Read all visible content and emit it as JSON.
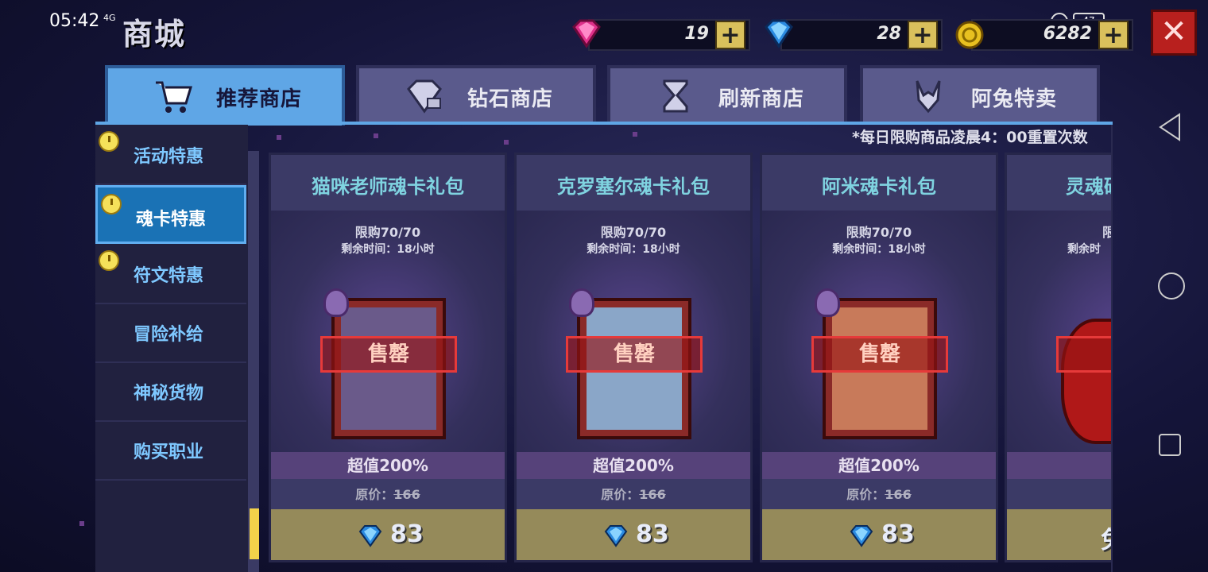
{
  "status_bar": {
    "time": "05:42",
    "signal": "4G",
    "battery": "47"
  },
  "title": "商城",
  "currencies": [
    {
      "name": "pink-gem",
      "value": "19",
      "plus": "+"
    },
    {
      "name": "blue-diamond",
      "value": "28",
      "plus": "+"
    },
    {
      "name": "gold-coin",
      "value": "6282",
      "plus": "+"
    }
  ],
  "close_label": "✕",
  "tabs": [
    {
      "label": "推荐商店",
      "icon": "cart-icon",
      "active": true
    },
    {
      "label": "钻石商店",
      "icon": "diamond-icon",
      "active": false
    },
    {
      "label": "刷新商店",
      "icon": "hourglass-icon",
      "active": false
    },
    {
      "label": "阿兔特卖",
      "icon": "rabbit-icon",
      "active": false
    }
  ],
  "sidebar": {
    "items": [
      {
        "label": "活动特惠",
        "timed": true,
        "active": false
      },
      {
        "label": "魂卡特惠",
        "timed": true,
        "active": true
      },
      {
        "label": "符文特惠",
        "timed": true,
        "active": false
      },
      {
        "label": "冒险补给",
        "timed": false,
        "active": false
      },
      {
        "label": "神秘货物",
        "timed": false,
        "active": false
      },
      {
        "label": "购买职业",
        "timed": false,
        "active": false
      }
    ]
  },
  "notice": "*每日限购商品凌晨4：00重置次数",
  "cards": [
    {
      "title": "猫咪老师魂卡礼包",
      "limit": "限购70/70",
      "remain": "剩余时间：18小时",
      "status": "售罄",
      "value": "超值200%",
      "orig_label": "原价：",
      "orig_price": "166",
      "price": "83",
      "art_color": "#6a5a8a"
    },
    {
      "title": "克罗塞尔魂卡礼包",
      "limit": "限购70/70",
      "remain": "剩余时间：18小时",
      "status": "售罄",
      "value": "超值200%",
      "orig_label": "原价：",
      "orig_price": "166",
      "price": "83",
      "art_color": "#8aa6c8"
    },
    {
      "title": "阿米魂卡礼包",
      "limit": "限购70/70",
      "remain": "剩余时间：18小时",
      "status": "售罄",
      "value": "超值200%",
      "orig_label": "原价：",
      "orig_price": "166",
      "price": "83",
      "art_color": "#c87a5a"
    },
    {
      "title": "灵魂砭",
      "limit": "限",
      "remain": "剩余时",
      "status": "售",
      "value": "",
      "orig_label": "",
      "orig_price": "",
      "price": "免",
      "art_color": "#a82020"
    }
  ]
}
